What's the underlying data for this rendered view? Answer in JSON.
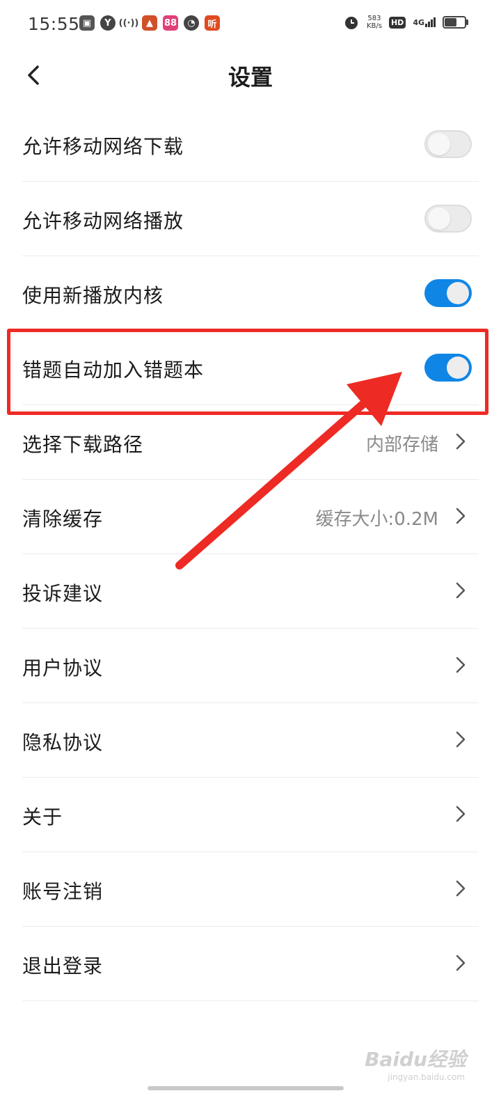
{
  "status_bar": {
    "time": "15:55",
    "net_speed_value": "583",
    "net_speed_unit": "KB/s",
    "hd": "HD",
    "network": "4G",
    "app_icons": [
      "video-icon",
      "y-icon",
      "hotspot-icon",
      "cake-icon",
      "grid-app-icon",
      "compass-icon",
      "listen-icon"
    ],
    "listen_glyph": "听"
  },
  "header": {
    "title": "设置"
  },
  "rows": [
    {
      "label": "允许移动网络下载",
      "type": "toggle",
      "on": false
    },
    {
      "label": "允许移动网络播放",
      "type": "toggle",
      "on": false
    },
    {
      "label": "使用新播放内核",
      "type": "toggle",
      "on": true
    },
    {
      "label": "错题自动加入错题本",
      "type": "toggle",
      "on": true
    },
    {
      "label": "选择下载路径",
      "type": "link",
      "value": "内部存储"
    },
    {
      "label": "清除缓存",
      "type": "link",
      "value": "缓存大小:0.2M"
    },
    {
      "label": "投诉建议",
      "type": "link"
    },
    {
      "label": "用户协议",
      "type": "link"
    },
    {
      "label": "隐私协议",
      "type": "link"
    },
    {
      "label": "关于",
      "type": "link"
    },
    {
      "label": "账号注销",
      "type": "link"
    },
    {
      "label": "退出登录",
      "type": "link"
    }
  ],
  "colors": {
    "accent": "#0f86e6",
    "annotation": "#ee2a24"
  },
  "watermark": {
    "brand": "Baidu经验",
    "url": "jingyan.baidu.com"
  }
}
